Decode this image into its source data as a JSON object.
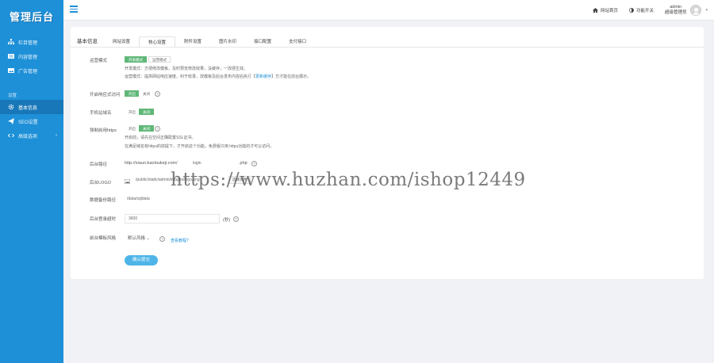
{
  "sidebar": {
    "logo": "管理后台",
    "items": [
      {
        "label": "栏目管理",
        "icon": "sitemap-icon",
        "active": false
      },
      {
        "label": "内容管理",
        "icon": "list-icon",
        "active": false
      },
      {
        "label": "广告管理",
        "icon": "image-icon",
        "active": false
      }
    ],
    "section": "设置",
    "settings_items": [
      {
        "label": "基本信息",
        "icon": "gear-icon",
        "active": true
      },
      {
        "label": "SEO设置",
        "icon": "paper-plane-icon",
        "active": false
      },
      {
        "label": "高级选项",
        "icon": "code-icon",
        "active": false,
        "has_arrow": true
      }
    ]
  },
  "topbar": {
    "home_link": "网站首页",
    "theme_toggle": "功能开关",
    "user_name": "admin",
    "user_role": "超级管理员"
  },
  "card": {
    "title": "基本信息",
    "tabs": [
      "网站设置",
      "核心设置",
      "附件设置",
      "图片水印",
      "接口配置",
      "支付接口"
    ],
    "active_tab": 1,
    "mode": {
      "label": "运营模式",
      "options": [
        "开发模式",
        "运营模式"
      ],
      "note1": "开发模式：方便修改模板，及时预览修改效果，没缓存，一改便生效。",
      "note2_pre": "运营模式：提高网站响应速度，利于收录，改模板及后台发布内容后执行【",
      "note2_link": "更新缓存",
      "note2_post": "】方才能在前台展示。"
    },
    "mobile": {
      "label": "开启响应式访问",
      "on": "开启",
      "off": "关闭"
    },
    "domain": {
      "label": "手机站域名",
      "on": "开启",
      "off": "关闭"
    },
    "https": {
      "label": "强制启用https",
      "on": "开启",
      "off": "关闭",
      "note1": "开启前，请先在空间正确配置SSL证书。",
      "note2": "在满足域名有https的前提下，才开启这个功能，免费版只用 https功能的才可以访问。"
    },
    "admin_path": {
      "label": "后台路径",
      "prefix": "http://xiaun.baoloukeji.com/",
      "value": "login",
      "suffix": ".php"
    },
    "logo": {
      "label": "后台LOGO",
      "value": "/public/static/admin/images/logo.png",
      "button": "选择文件"
    },
    "backup": {
      "label": "数据备份路径",
      "value": "/data/sqldata"
    },
    "timeout": {
      "label": "后台登录超时",
      "value": "3600",
      "unit": "(秒)"
    },
    "template": {
      "label": "前台模板风格",
      "value": "默认风格",
      "link": "查看教程?"
    },
    "submit": "确认提交"
  },
  "watermark": "https://www.huzhan.com/ishop12449"
}
